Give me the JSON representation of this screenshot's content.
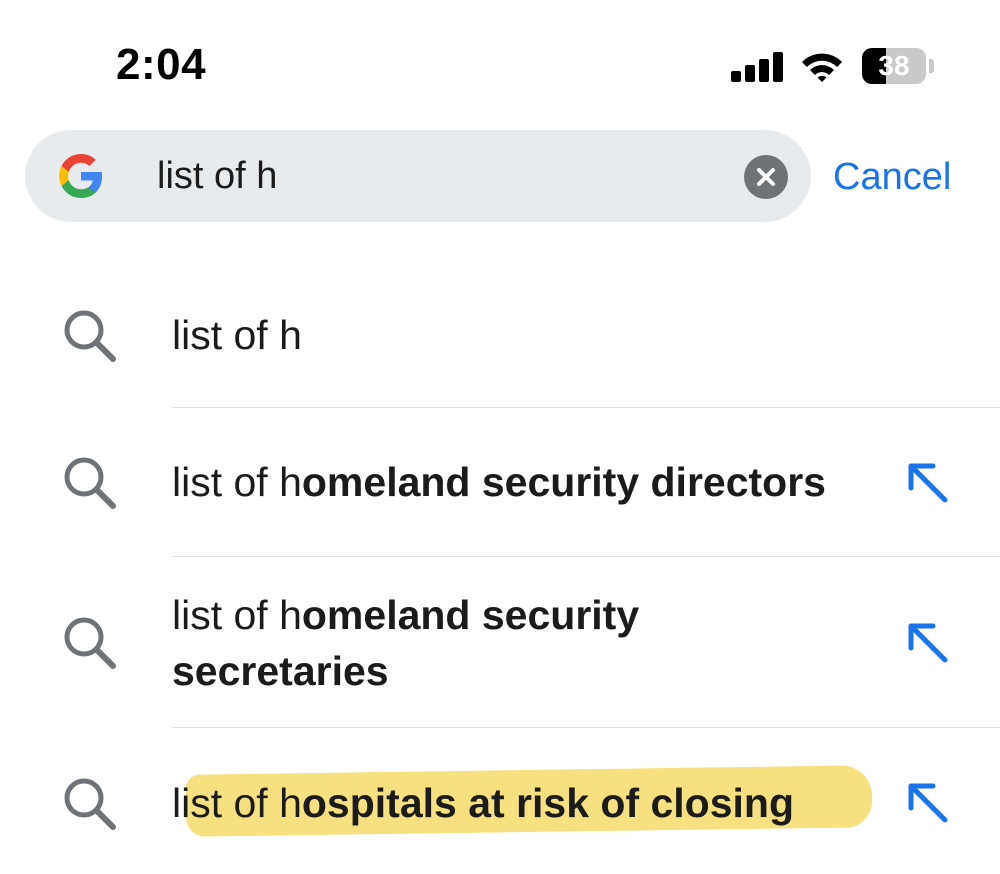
{
  "status_bar": {
    "time": "2:04",
    "battery_percent": "38",
    "battery_level": 0.38,
    "signal_icon": "cellular-signal-icon",
    "wifi_icon": "wifi-icon"
  },
  "search": {
    "logo_icon": "google-g-logo-icon",
    "value": "list of h",
    "clear_icon": "clear-text-icon",
    "cancel_label": "Cancel"
  },
  "suggestions": [
    {
      "typed": "list of h",
      "completion": "",
      "line2": ""
    },
    {
      "typed": "list of h",
      "completion": "omeland security directors",
      "line2": ""
    },
    {
      "typed": "list of h",
      "completion": "omeland security",
      "line2": "secretaries"
    },
    {
      "typed": "list of h",
      "completion": "ospitals at risk of closing",
      "line2": ""
    }
  ],
  "icons": {
    "suggestion_icon": "search-icon",
    "fill_icon": "arrow-up-left-icon"
  },
  "colors": {
    "accent": "#1a73e8",
    "search_bg": "#e8ebee",
    "icon_gray": "#6e7378",
    "highlight": "#f6da6a"
  }
}
